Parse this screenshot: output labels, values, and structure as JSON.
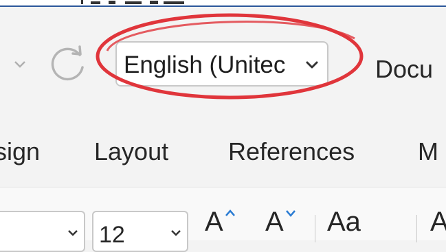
{
  "language_dropdown": {
    "value": "English (Unitec",
    "caret_icon": "chevron-down-icon"
  },
  "document_title": "Docu",
  "tabs": [
    {
      "label": "sign"
    },
    {
      "label": "Layout"
    },
    {
      "label": "References"
    },
    {
      "label": "M"
    }
  ],
  "ribbon": {
    "font_size_value": "12",
    "grow_font_label": "A",
    "shrink_font_label": "A",
    "change_case_label": "Aa",
    "clear_format_label": "A"
  },
  "colors": {
    "highlight_circle": "#e0353b",
    "ribbon_background": "#f3f3f3",
    "accent_blue": "#2b7cd3"
  }
}
